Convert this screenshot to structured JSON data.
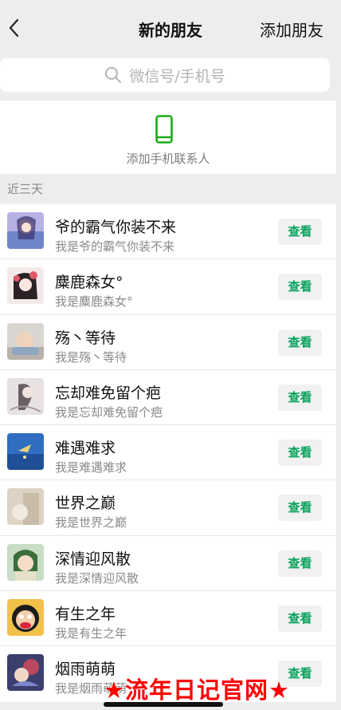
{
  "navbar": {
    "title": "新的朋友",
    "action_label": "添加朋友"
  },
  "search": {
    "placeholder": "微信号/手机号"
  },
  "phone_contacts": {
    "label": "添加手机联系人",
    "accent_color": "#1aad19"
  },
  "section": {
    "label": "近三天"
  },
  "requests": [
    {
      "name": "爷的霸气你装不来",
      "message": "我是爷的霸气你装不来",
      "button": "查看"
    },
    {
      "name": "麋鹿森女°",
      "message": "我是麋鹿森女°",
      "button": "查看"
    },
    {
      "name": "殇丶等待",
      "message": "我是殇丶等待",
      "button": "查看"
    },
    {
      "name": "忘却难免留个疤",
      "message": "我是忘却难免留个疤",
      "button": "查看"
    },
    {
      "name": "难遇难求",
      "message": "我是难遇难求",
      "button": "查看"
    },
    {
      "name": "世界之巅",
      "message": "我是世界之巅",
      "button": "查看"
    },
    {
      "name": "深情迎风散",
      "message": "我是深情迎风散",
      "button": "查看"
    },
    {
      "name": "有生之年",
      "message": "我是有生之年",
      "button": "查看"
    },
    {
      "name": "烟雨萌萌",
      "message": "我是烟雨萌萌",
      "button": "查看"
    }
  ],
  "watermark": {
    "text": "★流年日记官网★"
  },
  "colors": {
    "button_text": "#0aa35d",
    "background": "#ededed"
  }
}
